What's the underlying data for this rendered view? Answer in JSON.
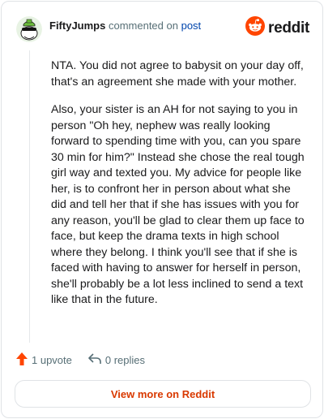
{
  "comment": {
    "username": "FiftyJumps",
    "verb": "commented on",
    "target": "post"
  },
  "brand": {
    "wordmark": "reddit",
    "color": "#ff4500"
  },
  "body": {
    "paragraphs": [
      "NTA. You did not agree to babysit on your day off, that's an agreement she made with your mother.",
      "Also, your sister is an AH for not saying to you in person \"Oh hey, nephew was really looking forward to spending time with you, can you spare 30 min for him?\" Instead she chose the real tough girl way and texted you. My advice for people like her, is to confront her in person about what she did and tell her that if she has issues with you for any reason, you'll be glad to clear them up face to face, but keep the drama texts in high school where they belong. I think you'll see that if she is faced with having to answer for herself in person, she'll probably be a lot less inclined to send a text like that in the future."
    ]
  },
  "actions": {
    "upvote_label": "1 upvote",
    "replies_label": "0 replies"
  },
  "footer": {
    "view_more_label": "View more on Reddit"
  },
  "icons": {
    "avatar": "snoo-avatar-icon",
    "logo": "reddit-logo-icon",
    "upvote": "upvote-arrow-icon",
    "reply": "reply-arrow-icon"
  },
  "colors": {
    "upvote": "#ff4500",
    "link": "#0045ac",
    "cta": "#d93900"
  }
}
